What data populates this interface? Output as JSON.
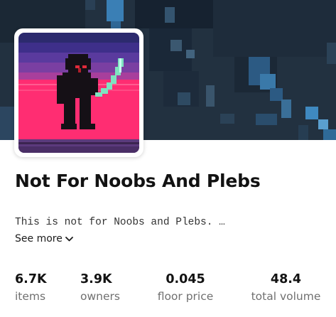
{
  "collection": {
    "name": "Not For Noobs And Plebs",
    "description": "This is not for Noobs and Plebs. …",
    "see_more_label": "See more"
  },
  "stats": [
    {
      "value": "6.7K",
      "label": "items"
    },
    {
      "value": "3.9K",
      "label": "owners"
    },
    {
      "value": "0.045",
      "label": "floor price"
    },
    {
      "value": "48.4",
      "label": "total volume"
    }
  ],
  "icons": {
    "see_more": "chevron-down-icon"
  },
  "colors": {
    "banner_bg": "#1f2d3b",
    "banner_accent": "#3f89c0",
    "avatar_purple": "#5a3a9e",
    "avatar_pink": "#ff2d72",
    "sword": "#7fe3c0"
  }
}
